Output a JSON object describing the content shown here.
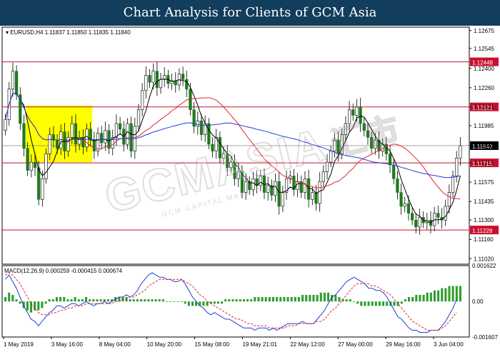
{
  "header": {
    "title": "Chart Analysis for Clients of GCM Asia"
  },
  "watermark": {
    "text": "GCMASIA",
    "chinese": "汇市",
    "sub": "GCM CAPITAL MARKETS"
  },
  "chart_data": [
    {
      "type": "candlestick",
      "info_line": "EURUSD,H4  1.11837 1.11850 1.11835 1.11840",
      "price_axis": {
        "ticks": [
          "1.12675",
          "1.12545",
          "1.12400",
          "1.12260",
          "1.12121",
          "1.11985",
          "1.11840",
          "1.11715",
          "1.11575",
          "1.11435",
          "1.11300",
          "1.11160",
          "1.11020"
        ],
        "range": [
          1.1098,
          1.1271
        ]
      },
      "x_tick_labels": [
        "1 May 2019",
        "3 May 16:00",
        "8 May 04:00",
        "10 May 20:00",
        "15 May 08:00",
        "19 May 21:01",
        "22 May 12:00",
        "27 May 00:00",
        "29 May 16:00",
        "3 Jun 04:00"
      ],
      "current_price": "1.11840",
      "levels": [
        {
          "value": 1.12448,
          "label": "1.12448"
        },
        {
          "value": 1.12121,
          "label": "1.12121"
        },
        {
          "value": 1.11715,
          "label": "1.11715"
        },
        {
          "value": 1.11228,
          "label": "1.11228"
        }
      ],
      "close_series": [
        1.1203,
        1.1225,
        1.1238,
        1.1221,
        1.12,
        1.1182,
        1.1166,
        1.1172,
        1.1168,
        1.1145,
        1.116,
        1.1178,
        1.1192,
        1.1188,
        1.1182,
        1.1194,
        1.118,
        1.119,
        1.12,
        1.1185,
        1.119,
        1.1183,
        1.1196,
        1.1188,
        1.118,
        1.1193,
        1.1186,
        1.1195,
        1.1182,
        1.119,
        1.12,
        1.1196,
        1.1185,
        1.12,
        1.118,
        1.1198,
        1.121,
        1.1224,
        1.1235,
        1.123,
        1.1238,
        1.1226,
        1.1232,
        1.1235,
        1.1229,
        1.1231,
        1.1228,
        1.1236,
        1.1232,
        1.1225,
        1.121,
        1.1198,
        1.1202,
        1.1192,
        1.12,
        1.1185,
        1.118,
        1.119,
        1.1175,
        1.1178,
        1.1168,
        1.1172,
        1.116,
        1.1165,
        1.115,
        1.1158,
        1.1152,
        1.116,
        1.1155,
        1.1162,
        1.115,
        1.1155,
        1.1148,
        1.1158,
        1.114,
        1.115,
        1.116,
        1.1162,
        1.1152,
        1.1158,
        1.115,
        1.116,
        1.1145,
        1.115,
        1.1142,
        1.1158,
        1.1165,
        1.1172,
        1.118,
        1.1188,
        1.1178,
        1.1192,
        1.12,
        1.121,
        1.1206,
        1.1212,
        1.12,
        1.1195,
        1.119,
        1.1182,
        1.1188,
        1.118,
        1.1185,
        1.1178,
        1.117,
        1.116,
        1.115,
        1.114,
        1.1142,
        1.1135,
        1.113,
        1.1125,
        1.1132,
        1.1128,
        1.113,
        1.1126,
        1.1135,
        1.1132,
        1.113,
        1.114,
        1.115,
        1.1162,
        1.1175,
        1.1184
      ],
      "moving_averages": [
        {
          "name": "MA fast",
          "color": "#000000"
        },
        {
          "name": "MA mid",
          "color": "#e0262e"
        },
        {
          "name": "MA slow",
          "color": "#1f3fd6"
        }
      ],
      "highlight_zone": {
        "color": "#ffff00"
      }
    },
    {
      "type": "bar",
      "label": "MACD(12,26,9) 0.000259 -0.000415 0.000674",
      "axis_ticks": [
        "0.001622",
        "0.00",
        "-0.001607"
      ],
      "range": [
        -0.001607,
        0.001622
      ],
      "macd": [
        0.001,
        0.0012,
        0.0009,
        0.0006,
        0.0002,
        -0.0002,
        -0.0005,
        -0.0008,
        -0.0009,
        -0.0011,
        -0.0009,
        -0.0007,
        -0.0005,
        -0.0004,
        -0.0002,
        -0.0002,
        -0.0003,
        -0.0002,
        -0.0001,
        -0.0001,
        -0.0002,
        -0.0001,
        0.0,
        -0.0001,
        -0.0002,
        -0.0001,
        -0.0001,
        0.0,
        -0.0001,
        0.0,
        0.0001,
        0.0002,
        0.0002,
        0.0003,
        0.0002,
        0.0003,
        0.0005,
        0.0008,
        0.001,
        0.0012,
        0.0013,
        0.0012,
        0.0011,
        0.0011,
        0.001,
        0.001,
        0.0009,
        0.0009,
        0.001,
        0.0008,
        0.0005,
        0.0002,
        0.0,
        -0.0002,
        -0.0003,
        -0.0005,
        -0.0006,
        -0.0005,
        -0.0006,
        -0.0007,
        -0.0008,
        -0.0008,
        -0.0009,
        -0.001,
        -0.0011,
        -0.0012,
        -0.0012,
        -0.0012,
        -0.0013,
        -0.0012,
        -0.0012,
        -0.0012,
        -0.0013,
        -0.0012,
        -0.0013,
        -0.0012,
        -0.0011,
        -0.001,
        -0.001,
        -0.001,
        -0.001,
        -0.0009,
        -0.001,
        -0.001,
        -0.001,
        -0.0008,
        -0.0006,
        -0.0004,
        -0.0001,
        0.0002,
        0.0003,
        0.0005,
        0.0007,
        0.0009,
        0.001,
        0.0011,
        0.001,
        0.0009,
        0.0008,
        0.0006,
        0.0006,
        0.0005,
        0.0005,
        0.0004,
        0.0002,
        -0.0001,
        -0.0004,
        -0.0007,
        -0.0008,
        -0.001,
        -0.0012,
        -0.0013,
        -0.0013,
        -0.0014,
        -0.0014,
        -0.0014,
        -0.0013,
        -0.0013,
        -0.0013,
        -0.0011,
        -0.0009,
        -0.0006,
        -0.0003,
        0.0001
      ],
      "signal": [
        0.0012,
        0.0013,
        0.0012,
        0.001,
        0.0008,
        0.0005,
        0.0002,
        -0.0001,
        -0.0003,
        -0.0005,
        -0.0006,
        -0.0006,
        -0.0006,
        -0.0005,
        -0.0005,
        -0.0004,
        -0.0004,
        -0.0003,
        -0.0003,
        -0.0002,
        -0.0002,
        -0.0002,
        -0.0001,
        -0.0001,
        -0.0001,
        -0.0001,
        -0.0001,
        -0.0001,
        -0.0001,
        -0.0001,
        0.0,
        0.0,
        0.0001,
        0.0001,
        0.0002,
        0.0002,
        0.0003,
        0.0004,
        0.0005,
        0.0007,
        0.0008,
        0.0009,
        0.001,
        0.001,
        0.001,
        0.001,
        0.001,
        0.001,
        0.001,
        0.0009,
        0.0008,
        0.0007,
        0.0005,
        0.0003,
        0.0002,
        0.0,
        -0.0001,
        -0.0002,
        -0.0003,
        -0.0004,
        -0.0005,
        -0.0006,
        -0.0007,
        -0.0008,
        -0.0008,
        -0.0009,
        -0.001,
        -0.001,
        -0.0011,
        -0.0011,
        -0.0011,
        -0.0011,
        -0.0012,
        -0.0012,
        -0.0012,
        -0.0012,
        -0.0012,
        -0.0011,
        -0.0011,
        -0.0011,
        -0.001,
        -0.001,
        -0.001,
        -0.001,
        -0.001,
        -0.0009,
        -0.0009,
        -0.0008,
        -0.0006,
        -0.0004,
        -0.0003,
        -0.0001,
        0.0001,
        0.0003,
        0.0005,
        0.0007,
        0.0008,
        0.0008,
        0.0008,
        0.0008,
        0.0007,
        0.0007,
        0.0006,
        0.0005,
        0.0004,
        0.0003,
        0.0001,
        -0.0001,
        -0.0003,
        -0.0005,
        -0.0007,
        -0.0009,
        -0.001,
        -0.0011,
        -0.0012,
        -0.0013,
        -0.0013,
        -0.0013,
        -0.0013,
        -0.0012,
        -0.0011,
        -0.0009,
        -0.0007,
        -0.0005
      ],
      "histogram": [
        0.0002,
        0.0004,
        0.0003,
        0.0001,
        -0.0001,
        -0.0003,
        -0.0004,
        -0.0005,
        -0.0004,
        -0.0004,
        -0.0003,
        -0.0001,
        0.0001,
        0.0001,
        0.0002,
        0.0002,
        0.0002,
        0.0001,
        0.0001,
        0.0002,
        0.0001,
        0.0001,
        0.0002,
        0.0001,
        0.0001,
        0.0001,
        0.0001,
        0.0001,
        0.0001,
        0.0001,
        0.0002,
        0.0002,
        0.0002,
        0.0002,
        0.0001,
        0.0001,
        0.0001,
        0.0001,
        0.0001,
        0.0001,
        0.0001,
        0.0001,
        0.0001,
        0.0001,
        0.0,
        0.0,
        0.0,
        0.0,
        0.0,
        -0.0001,
        -0.0002,
        -0.0002,
        -0.0002,
        -0.0002,
        -0.0002,
        -0.0002,
        -0.0001,
        -0.0001,
        -0.0001,
        -0.0001,
        0.0001,
        0.0001,
        0.0001,
        0.0001,
        0.0001,
        0.0001,
        0.0001,
        0.0001,
        0.0002,
        0.0002,
        0.0002,
        0.0002,
        0.0002,
        0.0002,
        0.0002,
        0.0002,
        0.0002,
        0.0002,
        0.0002,
        0.0002,
        0.0002,
        0.0003,
        0.0003,
        0.0003,
        0.0003,
        0.0003,
        0.0004,
        0.0004,
        0.0004,
        0.0003,
        0.0003,
        0.0002,
        0.0001,
        0.0001,
        0.0001,
        0.0,
        -0.0001,
        -0.0002,
        -0.0002,
        -0.0002,
        -0.0002,
        -0.0002,
        -0.0002,
        -0.0002,
        -0.0002,
        -0.0002,
        -0.0002,
        -0.0002,
        -0.0001,
        0.0001,
        0.0002,
        0.0002,
        0.0003,
        0.0003,
        0.0003,
        0.0004,
        0.0004,
        0.0005,
        0.0005,
        0.0006,
        0.0006,
        0.0007,
        0.0007,
        0.0007,
        0.0007
      ]
    }
  ]
}
